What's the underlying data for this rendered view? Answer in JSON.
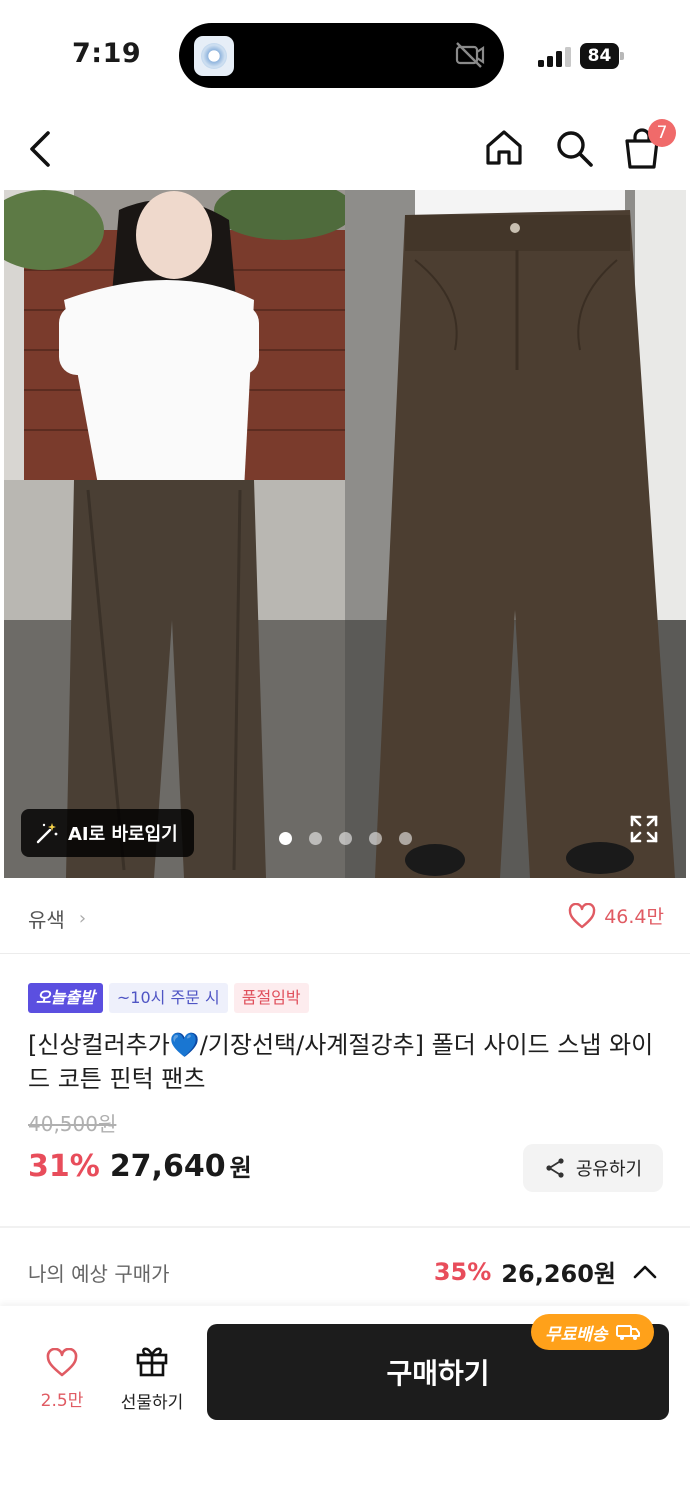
{
  "status_bar": {
    "time": "7:19",
    "battery": "84"
  },
  "nav": {
    "cart_badge": "7"
  },
  "hero": {
    "ai_chip_label": "AI로 바로입기",
    "carousel_total": 5,
    "carousel_active": 1
  },
  "meta": {
    "color_label": "유색",
    "color_chevron": "›",
    "likes": "46.4만"
  },
  "product": {
    "tags": [
      "오늘출발",
      "~10시 주문 시",
      "품절임박"
    ],
    "title": "[신상컬러추가💙/기장선택/사계절강추] 폴더 사이드 스냅 와이드 코튼 핀턱 팬츠",
    "original_price": "40,500원",
    "discount": "31%",
    "price": "27,640",
    "currency": "원",
    "share_label": "공유하기"
  },
  "expected": {
    "label": "나의 예상 구매가",
    "discount": "35%",
    "price": "26,260원"
  },
  "bottom": {
    "wish_count": "2.5만",
    "gift_label": "선물하기",
    "buy_label": "구매하기",
    "free_shipping": "무료배송"
  },
  "colors": {
    "accent_red": "#e84d5b",
    "badge_purple": "#5b4fe0",
    "free_ship_orange": "#ffa11a",
    "buy_button": "#1c1c1c"
  }
}
